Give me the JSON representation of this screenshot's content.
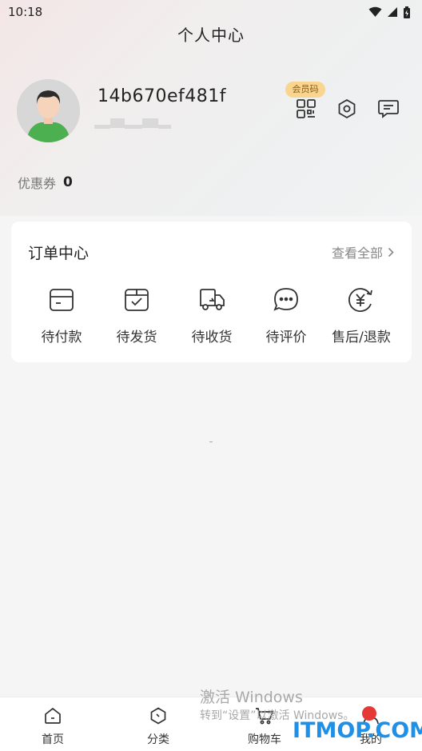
{
  "status_bar": {
    "time": "10:18",
    "icons": [
      "wifi-icon",
      "signal-icon",
      "battery-icon"
    ]
  },
  "page": {
    "title": "个人中心"
  },
  "profile": {
    "username": "14b670ef481f",
    "member_badge": "会员码",
    "actions": [
      "qrcode-icon",
      "settings-icon",
      "message-icon"
    ]
  },
  "coupon": {
    "label": "优惠券",
    "count": "0"
  },
  "orders": {
    "title": "订单中心",
    "view_all": "查看全部",
    "items": [
      {
        "label": "待付款",
        "icon": "wallet-icon"
      },
      {
        "label": "待发货",
        "icon": "package-icon"
      },
      {
        "label": "待收货",
        "icon": "truck-icon"
      },
      {
        "label": "待评价",
        "icon": "comment-icon"
      },
      {
        "label": "售后/退款",
        "icon": "refund-icon"
      }
    ]
  },
  "watermark": {
    "line1": "激活 Windows",
    "line2": "转到“设置”以激活 Windows。"
  },
  "tabbar": {
    "items": [
      {
        "label": "首页",
        "icon": "home-icon"
      },
      {
        "label": "分类",
        "icon": "category-icon"
      },
      {
        "label": "购物车",
        "icon": "cart-icon"
      },
      {
        "label": "我的",
        "icon": "user-icon"
      }
    ]
  },
  "site_watermark": "ITMOP.COM",
  "colors": {
    "accent_badge": "#f9d58f",
    "watermark_blue": "#1e90e8",
    "card_bg": "#ffffff",
    "page_bg": "#f5f5f5"
  }
}
